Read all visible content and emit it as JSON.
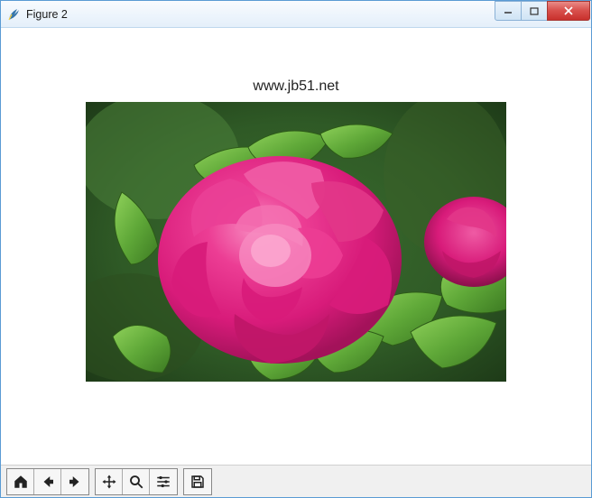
{
  "window": {
    "title": "Figure 2"
  },
  "figure": {
    "title": "www.jb51.net"
  },
  "toolbar": {
    "home": "Home",
    "back": "Back",
    "forward": "Forward",
    "pan": "Pan",
    "zoom": "Zoom",
    "configure": "Configure",
    "save": "Save"
  }
}
